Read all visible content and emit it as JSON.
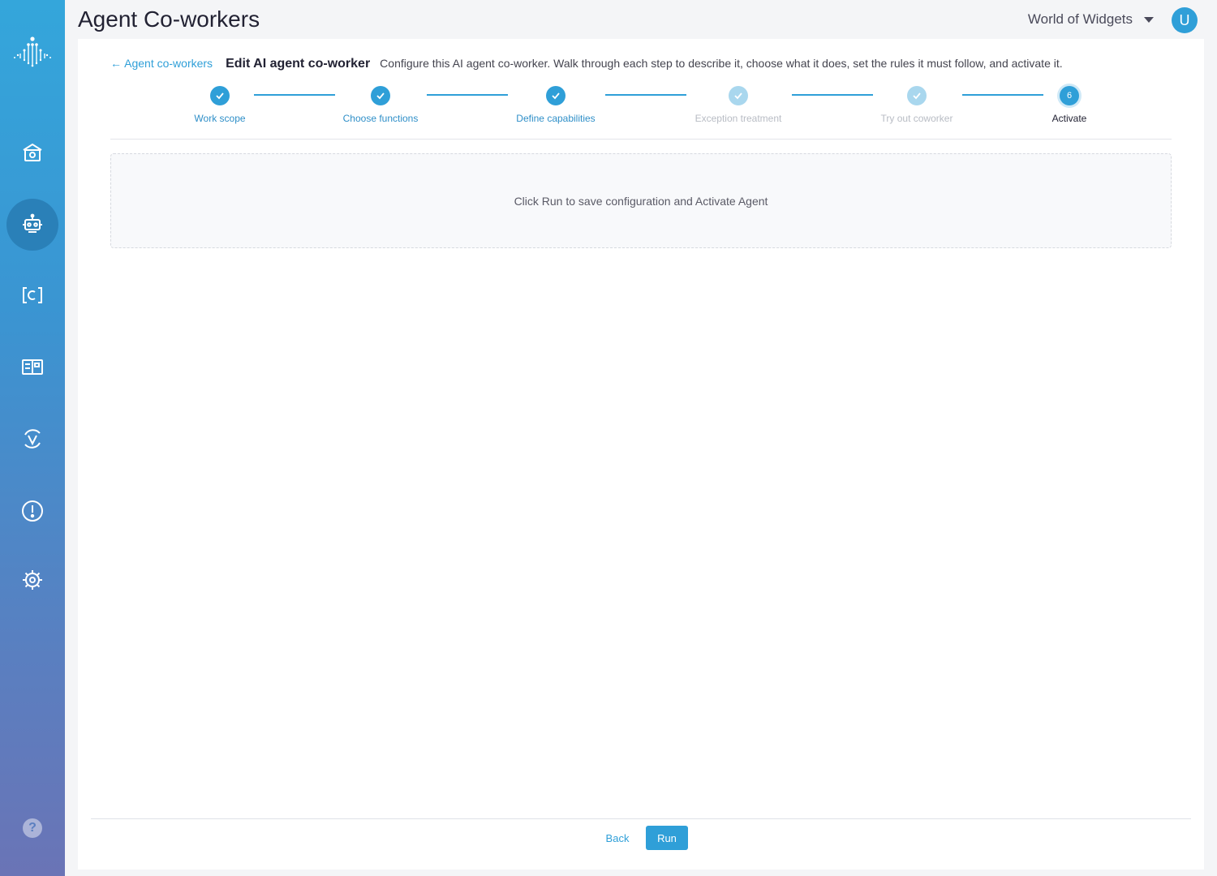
{
  "app": {
    "page_title": "Agent Co-workers",
    "org_name": "World of Widgets",
    "avatar_initial": "U"
  },
  "sidebar": {
    "items": [
      {
        "icon": "home-icon"
      },
      {
        "icon": "robot-icon",
        "active": true
      },
      {
        "icon": "c-bracket-icon"
      },
      {
        "icon": "book-icon"
      },
      {
        "icon": "v-cycle-icon"
      },
      {
        "icon": "alert-icon"
      },
      {
        "icon": "gear-icon"
      }
    ],
    "help_label": "?"
  },
  "header": {
    "back_label": "← Agent co-workers",
    "title": "Edit AI agent co-worker",
    "description": "Configure this AI agent co-worker. Walk through each step to describe it, choose what it does, set the rules it must follow, and activate it."
  },
  "steps": [
    {
      "label": "Work scope",
      "state": "done"
    },
    {
      "label": "Choose functions",
      "state": "done"
    },
    {
      "label": "Define capabilities",
      "state": "done"
    },
    {
      "label": "Exception treatment",
      "state": "faded"
    },
    {
      "label": "Try out coworker",
      "state": "faded"
    },
    {
      "label": "Activate",
      "state": "current",
      "number": "6"
    }
  ],
  "panel": {
    "message": "Click Run to save configuration and Activate Agent"
  },
  "footer": {
    "back_label": "Back",
    "run_label": "Run"
  },
  "colors": {
    "accent": "#2f9fd8",
    "faded": "#a9d7ee"
  }
}
